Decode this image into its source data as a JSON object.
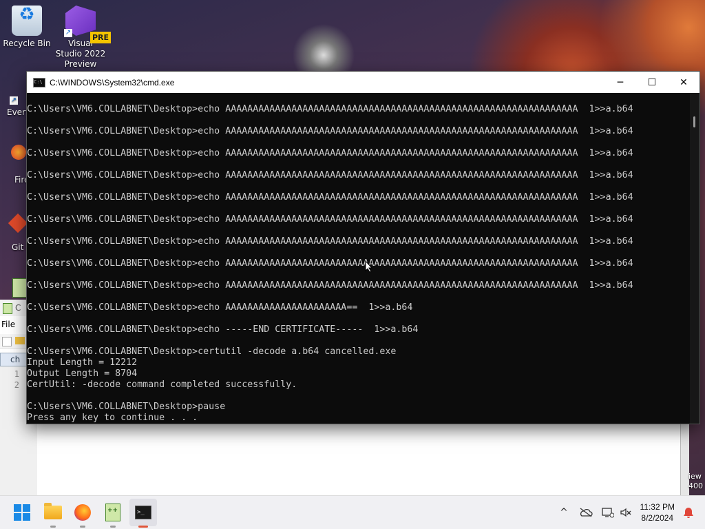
{
  "desktop": {
    "icons": [
      {
        "label": "Recycle Bin"
      },
      {
        "label": "Visual Studio 2022 Preview",
        "badge": "PRE"
      }
    ],
    "partial_labels": [
      "Every",
      "Fire",
      "Git E"
    ]
  },
  "background_window": {
    "title_fragment": "C",
    "menu": [
      "File",
      "E"
    ],
    "tab_fragment": "ch",
    "line_numbers": [
      "1",
      "2"
    ],
    "right_fragments": [
      "iew",
      "400"
    ]
  },
  "cmd_window": {
    "title": "C:\\WINDOWS\\System32\\cmd.exe",
    "controls": {
      "minimize": "─",
      "maximize": "☐",
      "close": "✕"
    },
    "lines": [
      {
        "text": "C:\\Users\\VM6.COLLABNET\\Desktop>echo AAAAAAAAAAAAAAAAAAAAAAAAAAAAAAAAAAAAAAAAAAAAAAAAAAAAAAAAAAAAAAAA  1>>a.b64"
      },
      {
        "text": "C:\\Users\\VM6.COLLABNET\\Desktop>echo AAAAAAAAAAAAAAAAAAAAAAAAAAAAAAAAAAAAAAAAAAAAAAAAAAAAAAAAAAAAAAAA  1>>a.b64"
      },
      {
        "text": "C:\\Users\\VM6.COLLABNET\\Desktop>echo AAAAAAAAAAAAAAAAAAAAAAAAAAAAAAAAAAAAAAAAAAAAAAAAAAAAAAAAAAAAAAAA  1>>a.b64"
      },
      {
        "text": "C:\\Users\\VM6.COLLABNET\\Desktop>echo AAAAAAAAAAAAAAAAAAAAAAAAAAAAAAAAAAAAAAAAAAAAAAAAAAAAAAAAAAAAAAAA  1>>a.b64"
      },
      {
        "text": "C:\\Users\\VM6.COLLABNET\\Desktop>echo AAAAAAAAAAAAAAAAAAAAAAAAAAAAAAAAAAAAAAAAAAAAAAAAAAAAAAAAAAAAAAAA  1>>a.b64"
      },
      {
        "text": "C:\\Users\\VM6.COLLABNET\\Desktop>echo AAAAAAAAAAAAAAAAAAAAAAAAAAAAAAAAAAAAAAAAAAAAAAAAAAAAAAAAAAAAAAAA  1>>a.b64"
      },
      {
        "text": "C:\\Users\\VM6.COLLABNET\\Desktop>echo AAAAAAAAAAAAAAAAAAAAAAAAAAAAAAAAAAAAAAAAAAAAAAAAAAAAAAAAAAAAAAAA  1>>a.b64"
      },
      {
        "text": "C:\\Users\\VM6.COLLABNET\\Desktop>echo AAAAAAAAAAAAAAAAAAAAAAAAAAAAAAAAAAAAAAAAAAAAAAAAAAAAAAAAAAAAAAAA  1>>a.b64"
      },
      {
        "text": "C:\\Users\\VM6.COLLABNET\\Desktop>echo AAAAAAAAAAAAAAAAAAAAAAAAAAAAAAAAAAAAAAAAAAAAAAAAAAAAAAAAAAAAAAAA  1>>a.b64"
      },
      {
        "text": "C:\\Users\\VM6.COLLABNET\\Desktop>echo AAAAAAAAAAAAAAAAAAAAAA==  1>>a.b64"
      },
      {
        "text": "C:\\Users\\VM6.COLLABNET\\Desktop>echo -----END CERTIFICATE-----  1>>a.b64"
      },
      {
        "text": "C:\\Users\\VM6.COLLABNET\\Desktop>certutil -decode a.b64 cancelled.exe"
      },
      {
        "text": "Input Length = 12212"
      },
      {
        "text": "Output Length = 8704"
      },
      {
        "text": "CertUtil: -decode command completed successfully."
      },
      {
        "text": "C:\\Users\\VM6.COLLABNET\\Desktop>pause"
      },
      {
        "text": "Press any key to continue . . ."
      }
    ]
  },
  "taskbar": {
    "apps": [
      {
        "name": "Start",
        "icon": "windows-logo-icon"
      },
      {
        "name": "File Explorer",
        "icon": "folder-icon"
      },
      {
        "name": "Firefox",
        "icon": "firefox-icon"
      },
      {
        "name": "Notepad++",
        "icon": "notepadpp-icon"
      },
      {
        "name": "Command Prompt",
        "icon": "terminal-icon",
        "active": true
      }
    ],
    "tray": {
      "chevron": "^",
      "time": "11:32 PM",
      "date": "8/2/2024"
    }
  }
}
